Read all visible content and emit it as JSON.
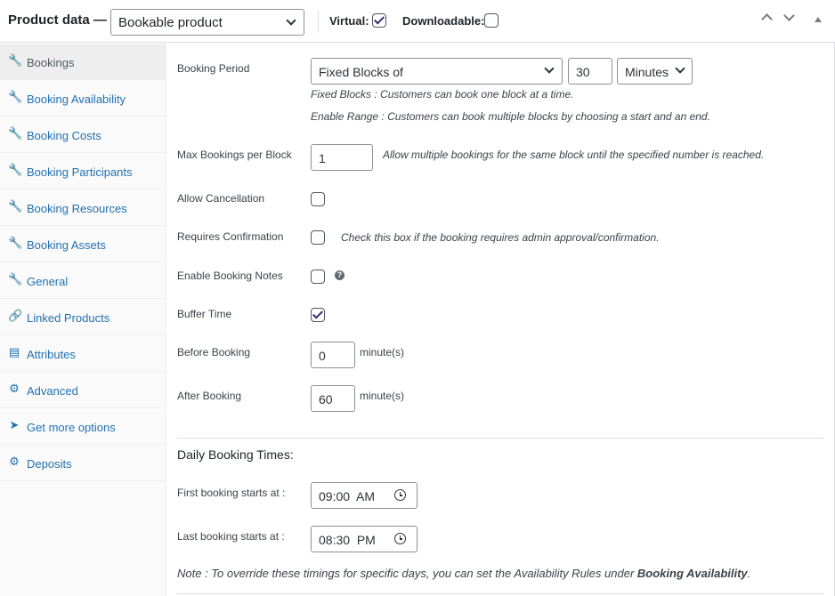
{
  "header": {
    "title": "Product data —",
    "product_type": "Bookable product",
    "virtual_label": "Virtual:",
    "virtual_checked": true,
    "downloadable_label": "Downloadable:",
    "downloadable_checked": false
  },
  "sidebar": {
    "items": [
      {
        "label": "Bookings",
        "icon": "wrench-icon",
        "active": true
      },
      {
        "label": "Booking Availability",
        "icon": "wrench-icon",
        "active": false
      },
      {
        "label": "Booking Costs",
        "icon": "wrench-icon",
        "active": false
      },
      {
        "label": "Booking Participants",
        "icon": "wrench-icon",
        "active": false
      },
      {
        "label": "Booking Resources",
        "icon": "wrench-icon",
        "active": false
      },
      {
        "label": "Booking Assets",
        "icon": "wrench-icon",
        "active": false
      },
      {
        "label": "General",
        "icon": "wrench-icon",
        "active": false
      },
      {
        "label": "Linked Products",
        "icon": "link-icon",
        "active": false
      },
      {
        "label": "Attributes",
        "icon": "list-icon",
        "active": false
      },
      {
        "label": "Advanced",
        "icon": "gear-icon",
        "active": false
      },
      {
        "label": "Get more options",
        "icon": "plugin-icon",
        "active": false
      },
      {
        "label": "Deposits",
        "icon": "gear-icon",
        "active": false
      }
    ]
  },
  "booking": {
    "period_label": "Booking Period",
    "period_type": "Fixed Blocks of",
    "period_value": "30",
    "period_unit": "Minutes",
    "period_desc_1": "Fixed Blocks : Customers can book one block at a time.",
    "period_desc_2": "Enable Range : Customers can book multiple blocks by choosing a start and an end.",
    "max_label": "Max Bookings per Block",
    "max_value": "1",
    "max_desc": "Allow multiple bookings for the same block until the specified number is reached.",
    "cancellation_label": "Allow Cancellation",
    "cancellation_checked": false,
    "confirmation_label": "Requires Confirmation",
    "confirmation_checked": false,
    "confirmation_desc": "Check this box if the booking requires admin approval/confirmation.",
    "notes_label": "Enable Booking Notes",
    "notes_checked": false,
    "notes_help": "?",
    "buffer_label": "Buffer Time",
    "buffer_checked": true,
    "before_label": "Before Booking",
    "before_value": "0",
    "before_unit": "minute(s)",
    "after_label": "After Booking",
    "after_value": "60",
    "after_unit": "minute(s)"
  },
  "daily": {
    "title": "Daily Booking Times:",
    "first_label": "First booking starts at :",
    "first_value": "09:00  AM",
    "last_label": "Last booking starts at :",
    "last_value": "08:30  PM",
    "note_prefix": "Note : To override these timings for specific days, you can set the Availability Rules under ",
    "note_link": "Booking Availability",
    "note_suffix": "."
  }
}
